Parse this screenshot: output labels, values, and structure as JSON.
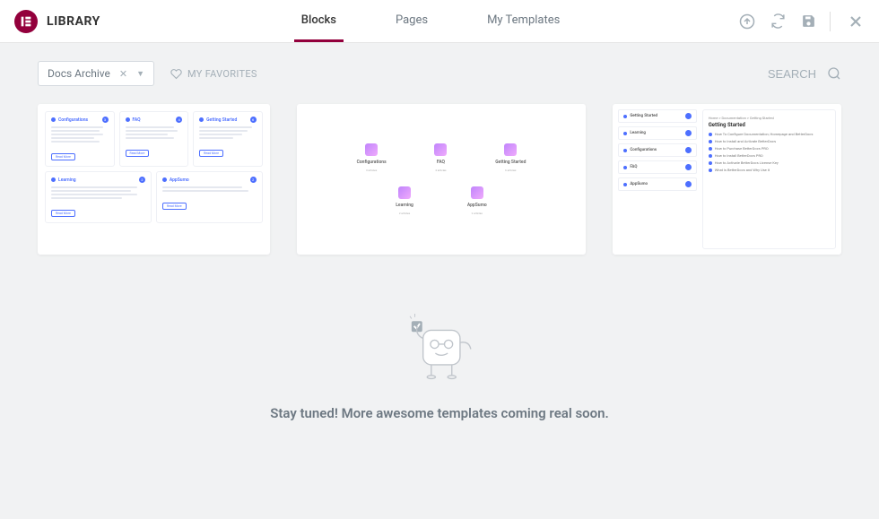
{
  "header": {
    "title": "LIBRARY",
    "tabs": [
      {
        "label": "Blocks",
        "active": true
      },
      {
        "label": "Pages",
        "active": false
      },
      {
        "label": "My Templates",
        "active": false
      }
    ]
  },
  "toolbar": {
    "filter_value": "Docs Archive",
    "favorites_label": "MY FAVORITES",
    "search_placeholder": "SEARCH"
  },
  "templates": {
    "t1": {
      "boxes_top": [
        "Configurations",
        "FAQ",
        "Getting Started"
      ],
      "boxes_bottom": [
        "Learning",
        "AppSumo"
      ],
      "btn": "Read More"
    },
    "t2": {
      "row1": [
        "Configurations",
        "FAQ",
        "Getting Started"
      ],
      "row2": [
        "Learning",
        "AppSumo"
      ]
    },
    "t3": {
      "sidebar": [
        "Getting Started",
        "Learning",
        "Configurations",
        "FAQ",
        "AppSumo"
      ],
      "crumb": "Home > Documentation > Getting Started",
      "title": "Getting Started",
      "items": [
        "How To Configure Documentation, Homepage and BetterDocs",
        "How to Install and Activate BetterDocs",
        "How to Purchase BetterDocs PRO",
        "How to Install BetterDocs PRO",
        "How to Activate BetterDocs License Key",
        "What is BetterDocs and Why Use it"
      ]
    }
  },
  "empty": {
    "text": "Stay tuned! More awesome templates coming real soon."
  }
}
